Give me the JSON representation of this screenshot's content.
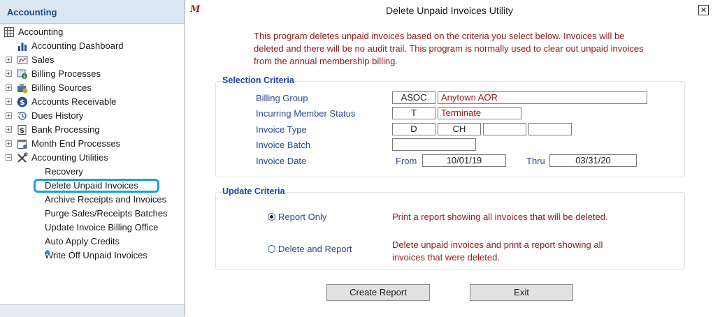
{
  "nav": {
    "header": "Accounting",
    "items": [
      {
        "label": "Accounting",
        "level": 0,
        "icon": "grid-icon"
      },
      {
        "label": "Accounting Dashboard",
        "level": 1,
        "icon": "bar-chart-icon"
      },
      {
        "label": "Sales",
        "level": 1,
        "icon": "sales-chart-icon",
        "expandable": true
      },
      {
        "label": "Billing Processes",
        "level": 1,
        "icon": "billing-icon",
        "expandable": true
      },
      {
        "label": "Billing Sources",
        "level": 1,
        "icon": "billing-sources-icon",
        "expandable": true
      },
      {
        "label": "Accounts Receivable",
        "level": 1,
        "icon": "dollar-icon",
        "expandable": true
      },
      {
        "label": "Dues History",
        "level": 1,
        "icon": "history-icon",
        "expandable": true
      },
      {
        "label": "Bank Processing",
        "level": 1,
        "icon": "bank-icon",
        "expandable": true
      },
      {
        "label": "Month End Processes",
        "level": 1,
        "icon": "calendar-icon",
        "expandable": true
      },
      {
        "label": "Accounting Utilities",
        "level": 1,
        "icon": "tools-icon",
        "expandable": true,
        "expanded": true
      },
      {
        "label": "Recovery",
        "level": 2
      },
      {
        "label": "Delete Unpaid Invoices",
        "level": 2,
        "selected": true
      },
      {
        "label": "Archive Receipts and Invoices",
        "level": 2
      },
      {
        "label": "Purge Sales/Receipts Batches",
        "level": 2
      },
      {
        "label": "Update Invoice Billing Office",
        "level": 2
      },
      {
        "label": "Auto Apply Credits",
        "level": 2
      },
      {
        "label": "Write Off Unpaid Invoices",
        "level": 2
      }
    ]
  },
  "dialog": {
    "logo": "M",
    "title": "Delete Unpaid Invoices Utility",
    "close_label": "✕",
    "description": "This program deletes unpaid invoices based on the criteria you select below. Invoices will be deleted and there will be no audit trail. This program is normally used to clear out unpaid invoices from the annual membership billing.",
    "selection": {
      "title": "Selection Criteria",
      "billing_group_label": "Billing Group",
      "billing_group_code": "ASOC",
      "billing_group_name": "Anytown AOR",
      "member_status_label": "Incurring Member Status",
      "member_status_code": "T",
      "member_status_name": "Terminate",
      "invoice_type_label": "Invoice Type",
      "invoice_types": [
        "D",
        "CH",
        "",
        ""
      ],
      "invoice_batch_label": "Invoice Batch",
      "invoice_batch": "",
      "invoice_date_label": "Invoice Date",
      "from_label": "From",
      "from_date": "10/01/19",
      "thru_label": "Thru",
      "thru_date": "03/31/20"
    },
    "update": {
      "title": "Update Criteria",
      "report_only_label": "Report Only",
      "report_only_desc": "Print a report showing all invoices that will be deleted.",
      "delete_report_label": "Delete and Report",
      "delete_report_desc": "Delete unpaid invoices and print a report showing all invoices that were deleted.",
      "selected": "report_only"
    },
    "buttons": {
      "create_report": "Create Report",
      "exit": "Exit"
    }
  },
  "colors": {
    "accent_blue": "#1f3fa8",
    "warning_red": "#8b1a1a",
    "highlight": "#1aa0dc"
  }
}
